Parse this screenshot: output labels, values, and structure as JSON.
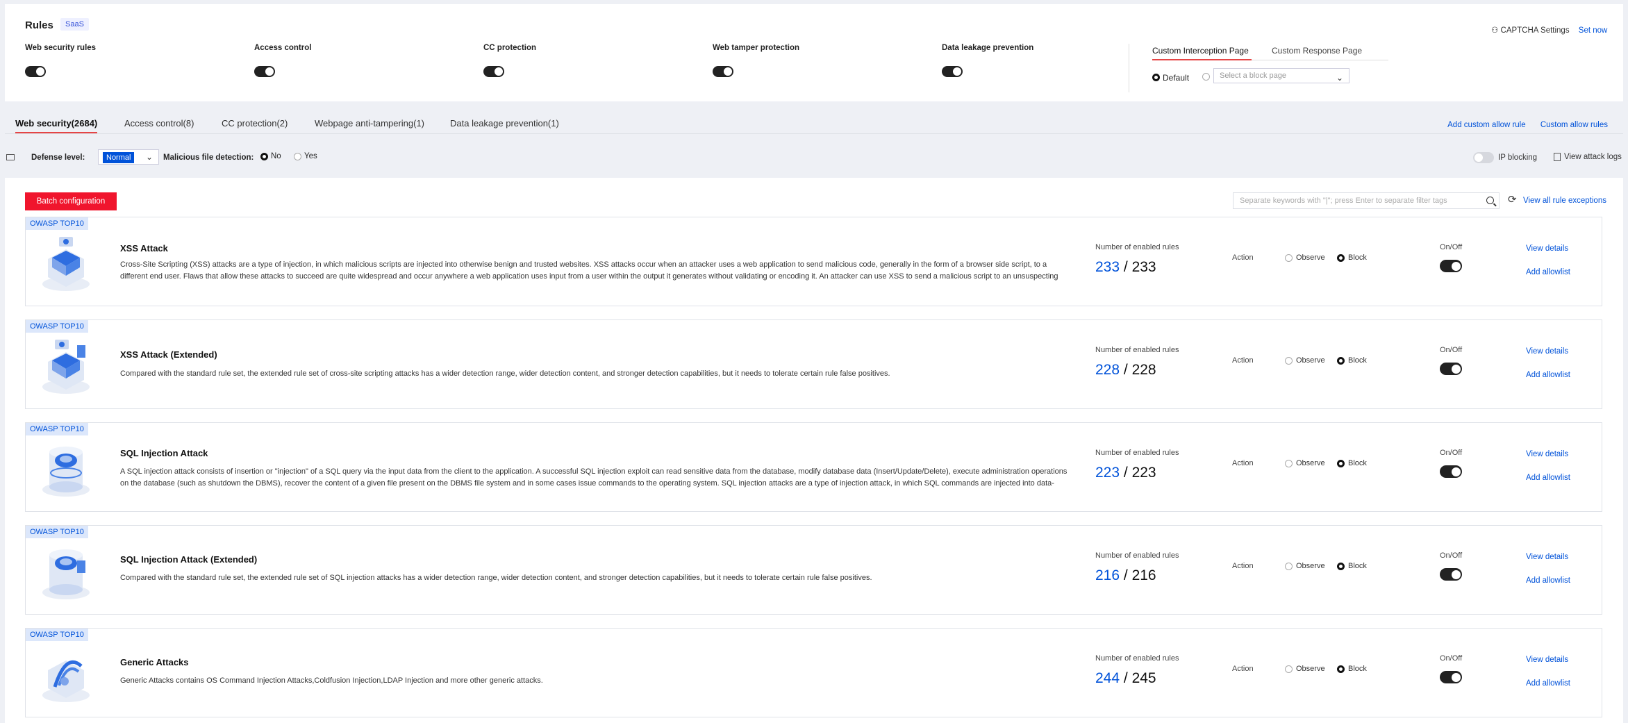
{
  "header": {
    "title": "Rules",
    "badge": "SaaS",
    "captcha_label": "CAPTCHA Settings",
    "captcha_link": "Set now"
  },
  "modules": [
    {
      "label": "Web security rules",
      "enabled": true
    },
    {
      "label": "Access control",
      "enabled": true
    },
    {
      "label": "CC protection",
      "enabled": true
    },
    {
      "label": "Web tamper protection",
      "enabled": true
    },
    {
      "label": "Data leakage prevention",
      "enabled": true
    }
  ],
  "interception": {
    "tabs": [
      "Custom Interception Page",
      "Custom Response Page"
    ],
    "default_label": "Default",
    "select_placeholder": "Select a block page"
  },
  "tabs": [
    "Web security(2684)",
    "Access control(8)",
    "CC protection(2)",
    "Webpage anti-tampering(1)",
    "Data leakage prevention(1)"
  ],
  "tab_links": [
    "Add custom allow rule",
    "Custom allow rules"
  ],
  "defense": {
    "label": "Defense level:",
    "value": "Normal",
    "malicious_label": "Malicious file detection:",
    "no": "No",
    "yes": "Yes",
    "ip_blocking": "IP blocking",
    "view_logs": "View attack logs"
  },
  "toolbar": {
    "batch": "Batch configuration",
    "search_placeholder": "Separate keywords with \"|\"; press Enter to separate filter tags",
    "exceptions": "View all rule exceptions"
  },
  "rule_labels": {
    "enabled": "Number of enabled rules",
    "action": "Action",
    "observe": "Observe",
    "block": "Block",
    "onoff": "On/Off",
    "view_details": "View details",
    "add_allowlist": "Add allowlist"
  },
  "rules": [
    {
      "badge": "OWASP TOP10",
      "title": "XSS Attack",
      "desc": "Cross-Site Scripting (XSS) attacks are a type of injection, in which malicious scripts are injected into otherwise benign and trusted websites. XSS attacks occur when an attacker uses a web application to send malicious code, generally in the form of a browser side script, to a different end user. Flaws that allow these attacks to succeed are quite widespread and occur anywhere a web application uses input from a user within the output it generates without validating or encoding it. An attacker can use XSS to send a malicious script to an unsuspecting user. The e...",
      "enabled": "233",
      "total": "233",
      "action": "Block",
      "on": true
    },
    {
      "badge": "OWASP TOP10",
      "title": "XSS Attack (Extended)",
      "desc": "Compared with the standard rule set, the extended rule set of cross-site scripting attacks has a wider detection range, wider detection content, and stronger detection capabilities, but it needs to tolerate certain rule false positives.",
      "enabled": "228",
      "total": "228",
      "action": "Block",
      "on": true
    },
    {
      "badge": "OWASP TOP10",
      "title": "SQL Injection Attack",
      "desc": "A SQL injection attack consists of insertion or \"injection\" of a SQL query via the input data from the client to the application. A successful SQL injection exploit can read sensitive data from the database, modify database data (Insert/Update/Delete), execute administration operations on the database (such as shutdown the DBMS), recover the content of a given file present on the DBMS file system and in some cases issue commands to the operating system. SQL injection attacks are a type of injection attack, in which SQL commands are injected into data-plan...",
      "enabled": "223",
      "total": "223",
      "action": "Block",
      "on": true
    },
    {
      "badge": "OWASP TOP10",
      "title": "SQL Injection Attack (Extended)",
      "desc": "Compared with the standard rule set, the extended rule set of SQL injection attacks has a wider detection range, wider detection content, and stronger detection capabilities, but it needs to tolerate certain rule false positives.",
      "enabled": "216",
      "total": "216",
      "action": "Block",
      "on": true
    },
    {
      "badge": "OWASP TOP10",
      "title": "Generic Attacks",
      "desc": "Generic Attacks contains OS Command Injection Attacks,Coldfusion Injection,LDAP Injection and more other generic attacks.",
      "enabled": "244",
      "total": "245",
      "action": "Block",
      "on": true
    }
  ]
}
